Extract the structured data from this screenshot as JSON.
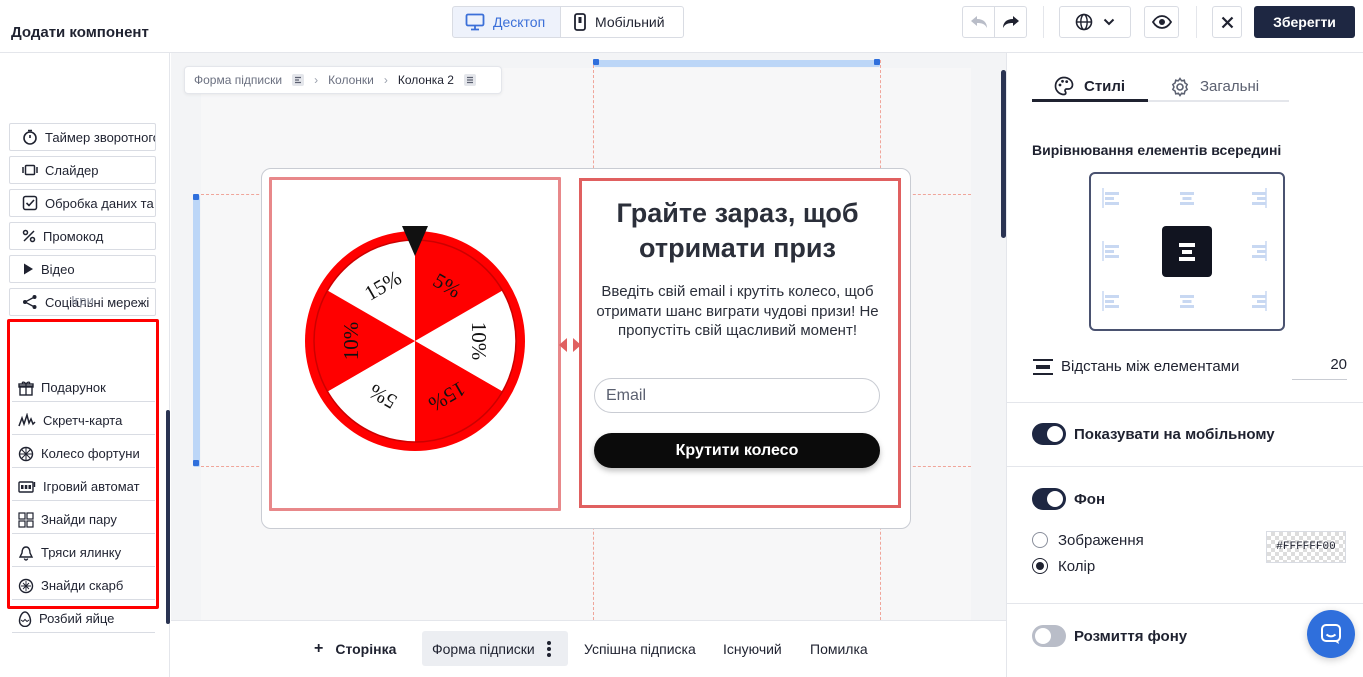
{
  "topbar": {
    "desktop_label": "Десктоп",
    "mobile_label": "Мобільний",
    "save_label": "Зберегти"
  },
  "left_panel": {
    "title": "Додати компонент",
    "components": [
      {
        "label": "Таймер зворотного відліку",
        "icon": "timer-icon"
      },
      {
        "label": "Слайдер",
        "icon": "slider-icon"
      },
      {
        "label": "Обробка даних та",
        "icon": "checkbox-icon"
      },
      {
        "label": "Промокод",
        "icon": "percent-icon"
      },
      {
        "label": "Відео",
        "icon": "play-icon"
      },
      {
        "label": "Соціальні мережі",
        "icon": "share-icon"
      }
    ],
    "games_label": "Ігри",
    "games": [
      {
        "label": "Подарунок",
        "icon": "gift-icon"
      },
      {
        "label": "Скретч-карта",
        "icon": "scratch-icon"
      },
      {
        "label": "Колесо фортуни",
        "icon": "wheel-icon"
      },
      {
        "label": "Ігровий автомат",
        "icon": "slot-machine-icon"
      },
      {
        "label": "Знайди пару",
        "icon": "cards-icon"
      },
      {
        "label": "Тряси ялинку",
        "icon": "bell-icon"
      },
      {
        "label": "Знайди скарб",
        "icon": "treasure-icon"
      },
      {
        "label": "Розбий яйце",
        "icon": "egg-icon"
      }
    ]
  },
  "breadcrumb": [
    "Форма підписки",
    "Колонки",
    "Колонка 2"
  ],
  "form": {
    "headline": "Грайте зараз, щоб отримати приз",
    "subtext": "Введіть свій email і крутіть колесо, щоб отримати шанс виграти чудові призи! Не пропустіть свій щасливий момент!",
    "email_placeholder": "Email",
    "button_label": "Крутити колесо",
    "wheel": {
      "segments": [
        "5%",
        "10%",
        "15%",
        "5%",
        "10%",
        "15%"
      ],
      "colors": {
        "red": "#ff0000",
        "white": "#ffffff"
      }
    }
  },
  "bottom_tabs": {
    "add_page": "Сторінка",
    "tabs": [
      "Форма підписки",
      "Успішна підписка",
      "Існуючий",
      "Помилка"
    ]
  },
  "right_panel": {
    "tabs": [
      "Стилі",
      "Загальні"
    ],
    "alignment_title": "Вирівнювання елементів всередині",
    "spacing_label": "Відстань між елементами",
    "spacing_value": "20",
    "show_mobile_label": "Показувати на мобільному",
    "show_mobile_on": true,
    "background_label": "Фон",
    "background_on": true,
    "bg_option_image": "Зображення",
    "bg_option_color": "Колір",
    "bg_selected": "Колір",
    "bg_color_value": "#FFFFFF00",
    "blur_label": "Розмиття фону",
    "blur_on": false
  },
  "colors": {
    "accent_blue": "#3b6fd8",
    "save_bg": "#1e2742",
    "selection_red": "#ff0000",
    "toggle_on": "#1e2742",
    "toggle_off": "#b9bdc8"
  }
}
